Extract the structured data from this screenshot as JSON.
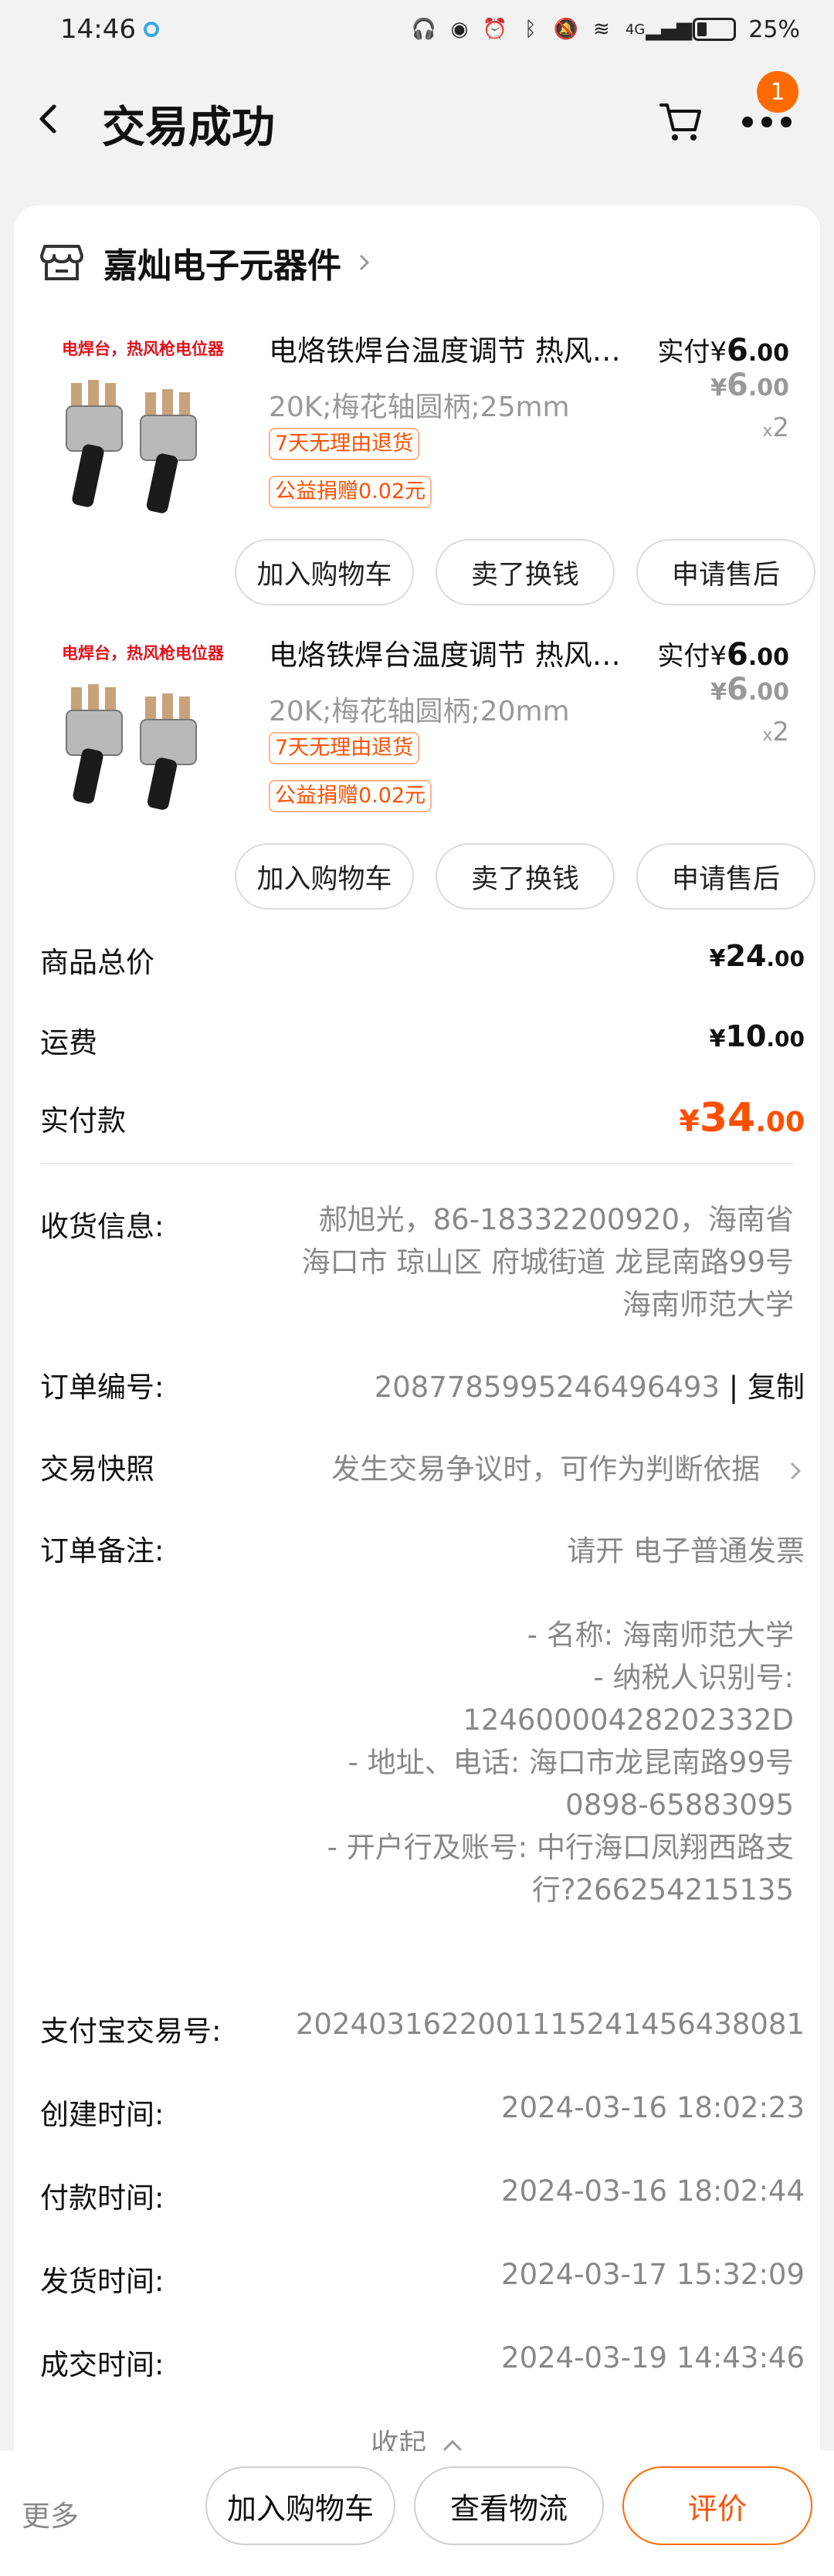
{
  "status": {
    "time": "14:46",
    "battery": "25%",
    "network": "4G"
  },
  "header": {
    "title": "交易成功",
    "cart_badge": "1"
  },
  "shop": {
    "name": "嘉灿电子元器件"
  },
  "items": [
    {
      "image_label": "电焊台，热风枪电位器",
      "name": "电烙铁焊台温度调节 热风枪电位器",
      "spec": "20K;梅花轴圆柄;25mm",
      "tags": [
        "7天无理由退货",
        "公益捐赠0.02元"
      ],
      "paid_label": "实付",
      "paid_currency": "¥",
      "paid_int": "6",
      "paid_dec": ".00",
      "orig_currency": "¥",
      "orig_int": "6",
      "orig_dec": ".00",
      "qty_prefix": "x",
      "qty": "2",
      "buttons": [
        "加入购物车",
        "卖了换钱",
        "申请售后"
      ]
    },
    {
      "image_label": "电焊台，热风枪电位器",
      "name": "电烙铁焊台温度调节 热风枪电位器",
      "spec": "20K;梅花轴圆柄;20mm",
      "tags": [
        "7天无理由退货",
        "公益捐赠0.02元"
      ],
      "paid_label": "实付",
      "paid_currency": "¥",
      "paid_int": "6",
      "paid_dec": ".00",
      "orig_currency": "¥",
      "orig_int": "6",
      "orig_dec": ".00",
      "qty_prefix": "x",
      "qty": "2",
      "buttons": [
        "加入购物车",
        "卖了换钱",
        "申请售后"
      ]
    }
  ],
  "summary": {
    "goods_total_label": "商品总价",
    "goods_total_cur": "¥",
    "goods_total_int": "24",
    "goods_total_dec": ".00",
    "shipping_label": "运费",
    "shipping_cur": "¥",
    "shipping_int": "10",
    "shipping_dec": ".00",
    "paid_label": "实付款",
    "paid_cur": "¥",
    "paid_int": "34",
    "paid_dec": ".00"
  },
  "info": {
    "address_label": "收货信息:",
    "address_lines": [
      "郝旭光，86-18332200920，海南省",
      "海口市 琼山区 府城街道 龙昆南路99号",
      "海南师范大学"
    ],
    "order_no_label": "订单编号:",
    "order_no": "2087785995246496493",
    "copy_label": "复制",
    "snapshot_label": "交易快照",
    "snapshot_value": "发生交易争议时，可作为判断依据",
    "remark_label": "订单备注:",
    "remark_title": "请开 电子普通发票",
    "remark_lines": [
      "- 名称:   海南师范大学",
      "- 纳税人识别号:",
      "12460000428202332D",
      "- 地址、电话:   海口市龙昆南路99号",
      "0898-65883095",
      "- 开户行及账号:  中行海口凤翔西路支",
      "行?266254215135"
    ],
    "alipay_label": "支付宝交易号:",
    "alipay_no": "2024031622001115241456438081",
    "created_label": "创建时间:",
    "created": "2024-03-16 18:02:23",
    "paid_label": "付款时间:",
    "paid": "2024-03-16 18:02:44",
    "shipped_label": "发货时间:",
    "shipped": "2024-03-17 15:32:09",
    "done_label": "成交时间:",
    "done": "2024-03-19 14:43:46",
    "collapse_label": "收起"
  },
  "bottom": {
    "more": "更多",
    "add_cart": "加入购物车",
    "logistics": "查看物流",
    "review": "评价"
  },
  "colors": {
    "accent": "#ff5000",
    "badge": "#ff6a00"
  }
}
